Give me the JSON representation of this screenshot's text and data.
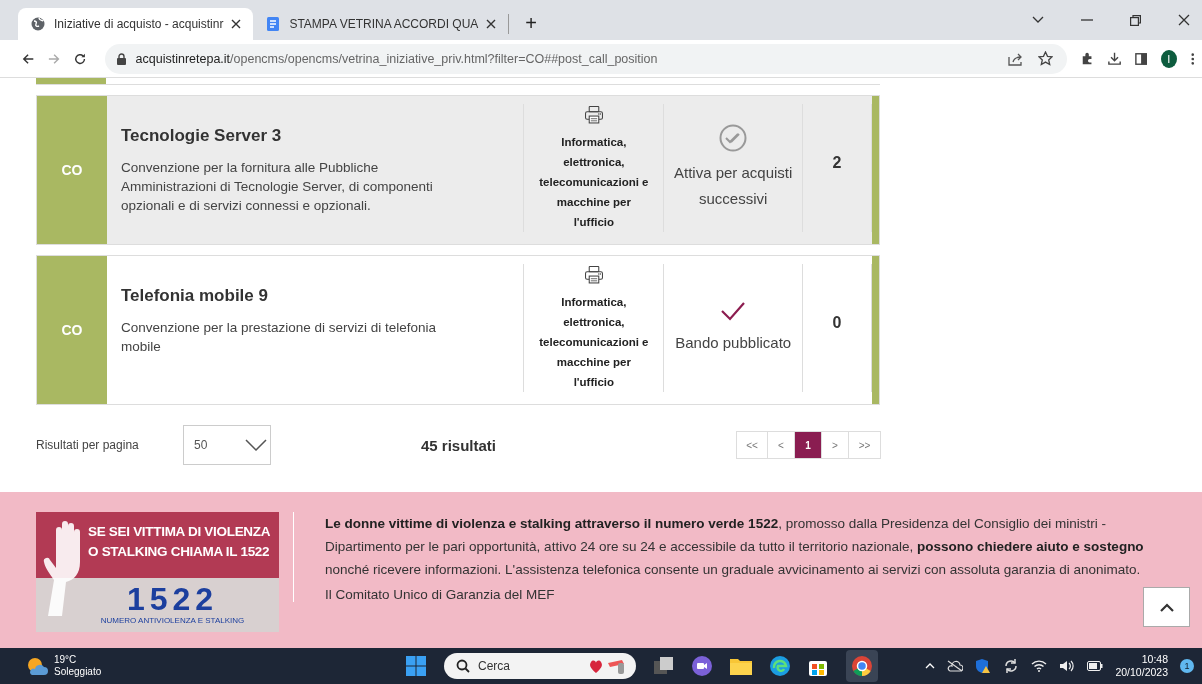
{
  "browser": {
    "tabs": [
      {
        "title": "Iniziative di acquisto - acquistinr",
        "selected": true
      },
      {
        "title": "STAMPA VETRINA ACCORDI QUA",
        "selected": false
      }
    ],
    "new_tab": "+",
    "url_host": "acquistinretepa.it",
    "url_path": "/opencms/opencms/vetrina_iniziative_priv.html?filter=CO##post_call_position",
    "profile": "I"
  },
  "rows": [
    {
      "type": "CO",
      "title": "Tecnologie Server 3",
      "description": "Convenzione per la fornitura alle Pubbliche Amministrazioni di Tecnologie Server, di componenti opzionali e di servizi connessi e opzionali.",
      "category": "Informatica, elettronica, telecomunicazioni e macchine per l'ufficio",
      "status": "Attiva per acquisti successivi",
      "kind": "double-check",
      "count": "2",
      "shaded": true
    },
    {
      "type": "CO",
      "title": "Telefonia mobile 9",
      "description": "Convenzione per la prestazione di servizi di telefonia mobile",
      "category": "Informatica, elettronica, telecomunicazioni e macchine per l'ufficio",
      "status": "Bando pubblicato",
      "kind": "check",
      "count": "0",
      "shaded": false
    }
  ],
  "results": {
    "per_page_label": "Risultati per pagina",
    "per_page": "50",
    "total": "45 risultati",
    "pages": [
      {
        "label": "<<",
        "selected": false
      },
      {
        "label": "<",
        "selected": false
      },
      {
        "label": "1",
        "selected": true
      },
      {
        "label": ">",
        "selected": false
      },
      {
        "label": ">>",
        "selected": false
      }
    ]
  },
  "footer": {
    "banner": {
      "headline_1": "SE SEI VITTIMA DI VIOLENZA",
      "headline_2": "O STALKING CHIAMA IL 1522",
      "number": "1522",
      "caption": "NUMERO ANTIVIOLENZA E STALKING"
    },
    "text": "**Le donne vittime di violenza e stalking attraverso il numero verde 1522**, promosso dalla Presidenza del Consiglio dei ministri - Dipartimento per le pari opportunità, attivo 24 ore su 24 e accessibile da tutto il territorio nazionale, **possono chiedere aiuto e sostegno** nonché ricevere informazioni. L'assistenza telefonica consente un graduale avvicinamento ai servizi con assoluta garanzia di anonimato.",
    "signature": "Il Comitato Unico di Garanzia del MEF"
  },
  "taskbar": {
    "temperature": "19°C",
    "weather": "Soleggiato",
    "search": "Cerca",
    "time": "10:48",
    "date": "20/10/2023",
    "notifications": "1"
  }
}
